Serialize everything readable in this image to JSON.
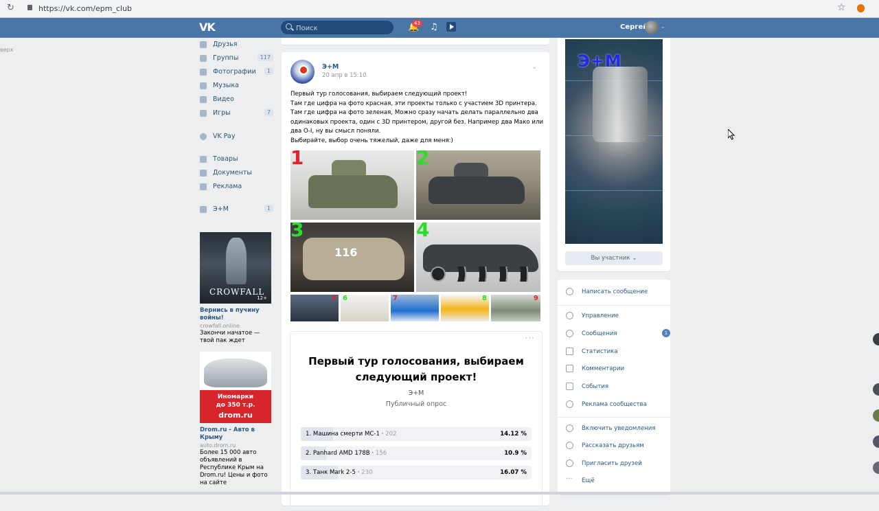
{
  "browser": {
    "url": "https://vk.com/epm_club"
  },
  "header": {
    "search_placeholder": "Поиск",
    "notifications_count": "43",
    "user_name": "Сергей"
  },
  "left_stub": "верх",
  "leftnav": {
    "items": [
      {
        "label": "Друзья",
        "count": "",
        "icon": "friends-icon"
      },
      {
        "label": "Группы",
        "count": "117",
        "icon": "groups-icon"
      },
      {
        "label": "Фотографии",
        "count": "1",
        "icon": "camera-icon"
      },
      {
        "label": "Музыка",
        "count": "",
        "icon": "music-icon"
      },
      {
        "label": "Видео",
        "count": "",
        "icon": "video-icon"
      },
      {
        "label": "Игры",
        "count": "7",
        "icon": "gamepad-icon"
      },
      {
        "label": "VK Pay",
        "count": "",
        "icon": "vkpay-icon"
      },
      {
        "label": "Товары",
        "count": "",
        "icon": "goods-icon"
      },
      {
        "label": "Документы",
        "count": "",
        "icon": "documents-icon"
      },
      {
        "label": "Реклама",
        "count": "",
        "icon": "ads-icon"
      },
      {
        "label": "Э+М",
        "count": "1",
        "icon": "community-icon"
      }
    ]
  },
  "ads": [
    {
      "image_text": "CROWFALL",
      "age": "12+",
      "title": "Вернись в пучину войны!",
      "domain": "crowfall.online",
      "desc": "Закончи начатое — твой пак ждет"
    },
    {
      "image_text_1": "Иномарки",
      "image_text_2": "до 350 т.р.",
      "image_text_3": "drom.ru",
      "title": "Drom.ru - Авто в Крыму",
      "domain": "auto.drom.ru",
      "desc": "Более 15 000 авто объявлений в Республике Крым на Drom.ru! Цены и фото на сайте"
    }
  ],
  "post": {
    "author": "Э+М",
    "date": "20 апр в 15:10",
    "text_lines": [
      "Первый тур голосования, выбираем следующий проект!",
      "Там где цифра на фото красная, эти проекты только с участием 3D принтера.",
      "Там где цифра на фото зеленая, Можно сразу начать делать параллельно два",
      "одинаковых проекта, один с 3D принтером, другой без. Например два Мако или",
      "два О-I, ну вы смысл поняли.",
      "Выбирайте, выбор очень тяжелый, даже для меня:)"
    ],
    "photos": [
      {
        "num": "1",
        "color": "#e8202a"
      },
      {
        "num": "2",
        "color": "#2bdc2b"
      },
      {
        "num": "3",
        "color": "#2bdc2b"
      },
      {
        "num": "4",
        "color": "#2bdc2b"
      },
      {
        "num": "5",
        "color": "#e8202a"
      },
      {
        "num": "6",
        "color": "#2bdc2b"
      },
      {
        "num": "7",
        "color": "#e8202a"
      },
      {
        "num": "8",
        "color": "#2bdc2b"
      },
      {
        "num": "9",
        "color": "#e8202a"
      }
    ],
    "tank3_marking": "116"
  },
  "poll": {
    "title": "Первый тур голосования, выбираем следующий проект!",
    "author": "Э+М",
    "type": "Публичный опрос",
    "options": [
      {
        "label": "1. Машина смерти МС-1",
        "count": "202",
        "pct": "14.12 %",
        "fraction": 0.1412
      },
      {
        "label": "2. Panhard AMD 178B",
        "count": "156",
        "pct": "10.9 %",
        "fraction": 0.109
      },
      {
        "label": "3. Танк Mark 2-5",
        "count": "230",
        "pct": "16.07 %",
        "fraction": 0.1607
      }
    ]
  },
  "cover": {
    "logo": "Э+М",
    "member_button": "Вы участник"
  },
  "actions": {
    "write": "Написать сообщение",
    "items": [
      {
        "label": "Управление",
        "badge": ""
      },
      {
        "label": "Сообщения",
        "badge": "1"
      },
      {
        "label": "Статистика",
        "badge": ""
      },
      {
        "label": "Комментарии",
        "badge": ""
      },
      {
        "label": "События",
        "badge": ""
      },
      {
        "label": "Реклама сообщества",
        "badge": ""
      }
    ],
    "items2": [
      {
        "label": "Включить уведомления"
      },
      {
        "label": "Рассказать друзьям"
      },
      {
        "label": "Пригласить друзей"
      },
      {
        "label": "Ещё"
      }
    ]
  }
}
